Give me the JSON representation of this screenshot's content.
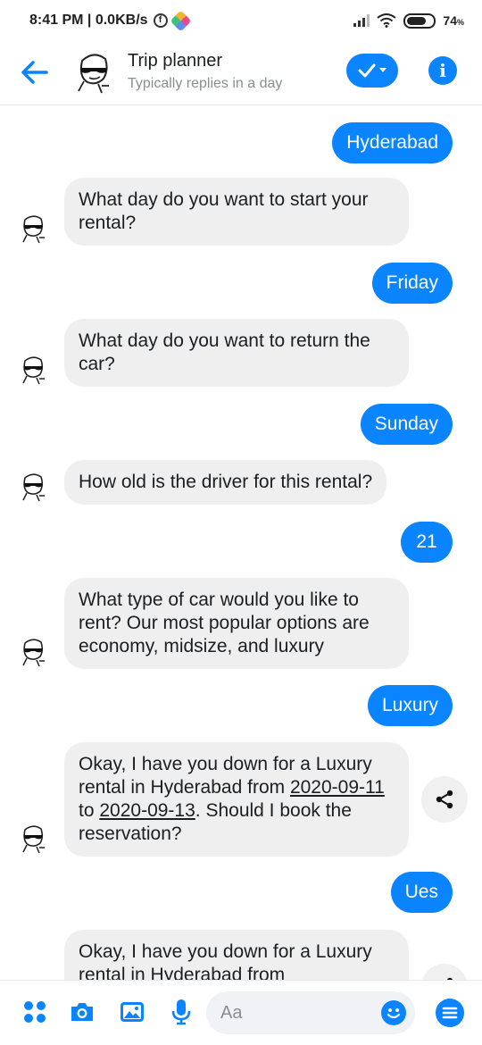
{
  "status": {
    "time_speed": "8:41 PM | 0.0KB/s",
    "battery": "74",
    "battery_unit": "%",
    "battery_level": 0.74
  },
  "header": {
    "title": "Trip planner",
    "subtitle": "Typically replies in a day"
  },
  "messages": {
    "out_1": "Hyderabad",
    "in_1": "What day do you want to start your rental?",
    "out_2": "Friday",
    "in_2": "What day do you want to return the car?",
    "out_3": "Sunday",
    "in_3": "How old is the driver for this rental?",
    "out_4": "21",
    "in_4": "What type of car would you like to rent?  Our most popular options are economy, midsize, and luxury",
    "out_5": "Luxury",
    "in_5_before": "Okay, I have you down for a Luxury rental in Hyderabad from ",
    "in_5_date1": "2020-09-11",
    "in_5_mid": " to ",
    "in_5_date2": "2020-09-13",
    "in_5_after": ".  Should I book the reservation?",
    "out_6": "Ues",
    "in_6": "Okay, I have you down for a Luxury rental in Hyderabad from"
  },
  "composer": {
    "placeholder": "Aa"
  },
  "colors": {
    "accent": "#0a84ff",
    "incoming_bubble": "#efefef"
  }
}
